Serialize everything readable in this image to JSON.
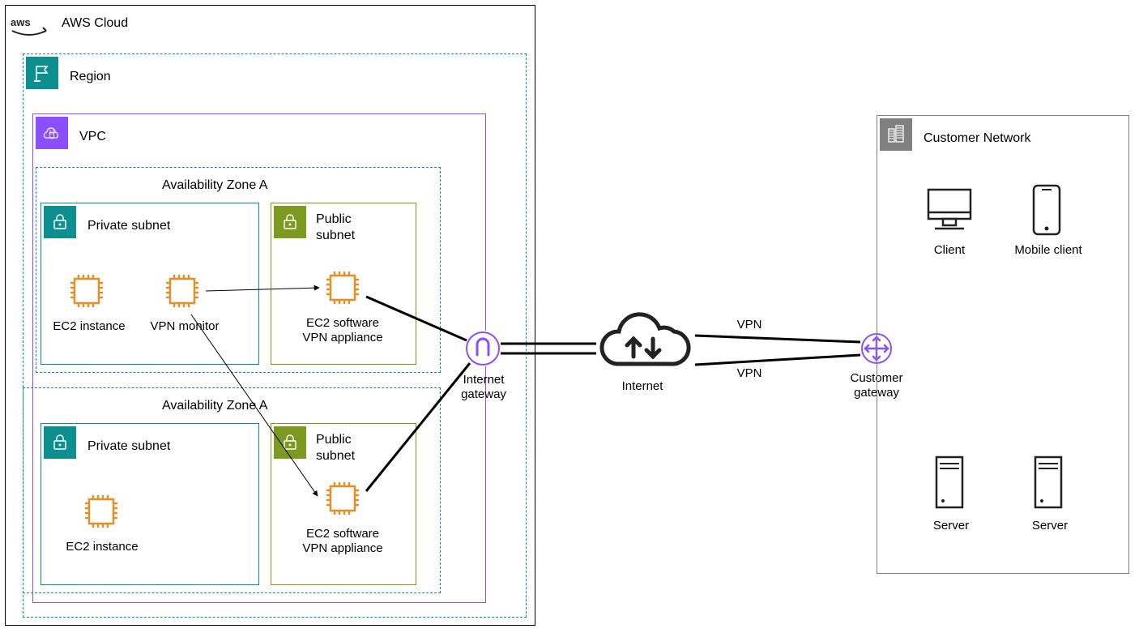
{
  "awsCloud": {
    "label": "AWS Cloud"
  },
  "region": {
    "label": "Region"
  },
  "vpc": {
    "label": "VPC"
  },
  "azA": {
    "label": "Availability Zone A"
  },
  "azB": {
    "label": "Availability Zone A"
  },
  "privSubnetA": {
    "label": "Private subnet"
  },
  "pubSubnetA": {
    "label1": "Public",
    "label2": "subnet"
  },
  "privSubnetB": {
    "label": "Private subnet"
  },
  "pubSubnetB": {
    "label1": "Public",
    "label2": "subnet"
  },
  "ec2a": "EC2 instance",
  "vpnMonitor": "VPN monitor",
  "ec2SoftA1": "EC2 software",
  "ec2SoftA2": "VPN appliance",
  "ec2b": "EC2 instance",
  "ec2SoftB1": "EC2 software",
  "ec2SoftB2": "VPN appliance",
  "igw1": "Internet",
  "igw2": "gateway",
  "internet": "Internet",
  "vpn": "VPN",
  "cgw1": "Customer",
  "cgw2": "gateway",
  "customerNetwork": {
    "label": "Customer Network"
  },
  "client": "Client",
  "mobileClient": "Mobile client",
  "server": "Server",
  "colors": {
    "teal": "#0e8f8f",
    "purple": "#8a4fff",
    "olive": "#7b9a1f",
    "orange": "#e58f27",
    "dark": "#222",
    "grey": "#808080"
  }
}
